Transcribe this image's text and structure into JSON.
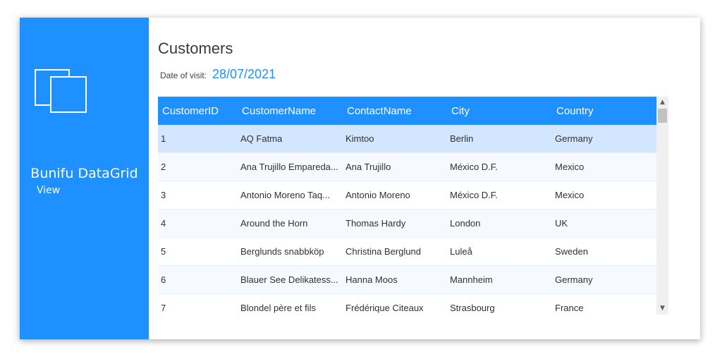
{
  "sidebar": {
    "title": "Bunifu DataGrid",
    "subtitle": "View",
    "icon": "copy-windows-icon",
    "background": "#1e90ff"
  },
  "main": {
    "title": "Customers",
    "date_label": "Date of visit:",
    "date_value": "28/07/2021",
    "accent": "#1e90ff"
  },
  "grid": {
    "columns": [
      "CustomerID",
      "CustomerName",
      "ContactName",
      "City",
      "Country"
    ],
    "selected_row": 0,
    "rows": [
      [
        "1",
        "AQ Fatma",
        "Kimtoo",
        "Berlin",
        "Germany"
      ],
      [
        "2",
        "Ana Trujillo Empareda...",
        "Ana Trujillo",
        "México D.F.",
        "Mexico"
      ],
      [
        "3",
        "Antonio Moreno Taq...",
        "Antonio Moreno",
        "México D.F.",
        "Mexico"
      ],
      [
        "4",
        "Around the Horn",
        "Thomas Hardy",
        "London",
        "UK"
      ],
      [
        "5",
        "Berglunds snabbköp",
        "Christina Berglund",
        "Luleå",
        "Sweden"
      ],
      [
        "6",
        "Blauer See Delikatess...",
        "Hanna Moos",
        "Mannheim",
        "Germany"
      ],
      [
        "7",
        "Blondel père et fils",
        "Frédérique Citeaux",
        "Strasbourg",
        "France"
      ]
    ]
  },
  "scrollbar": {
    "up_icon": "chevron-up-icon",
    "down_icon": "chevron-down-icon"
  }
}
